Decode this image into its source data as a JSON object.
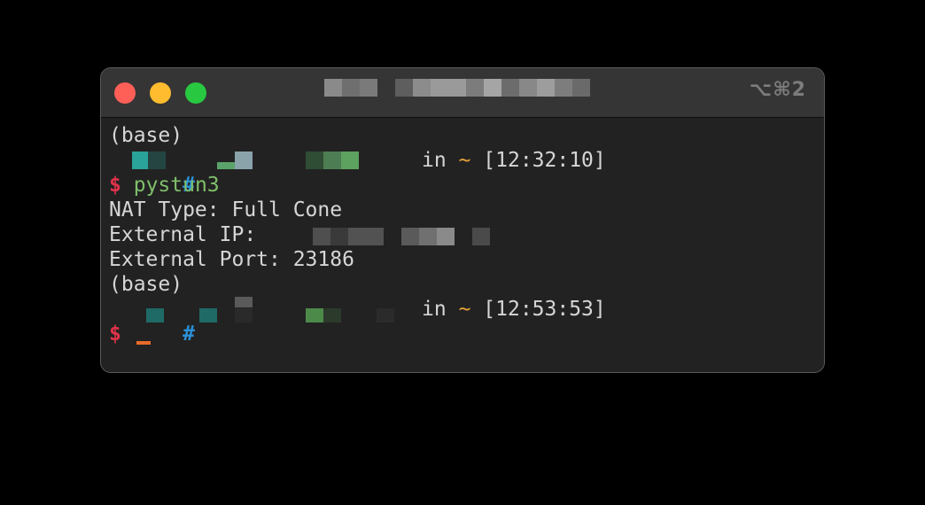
{
  "window": {
    "shortcut": "⌥⌘2"
  },
  "terminal": {
    "lines": {
      "base1": "(base)",
      "prompt1": {
        "hash": "#",
        "in": "in",
        "dir": "~",
        "time": "[12:32:10]"
      },
      "cmd1": {
        "dollar": "$",
        "command": "pystun3"
      },
      "nat_type": "NAT Type: Full Cone",
      "external_ip": "External IP:",
      "external_port": "External Port: 23186",
      "base2": "(base)",
      "prompt2": {
        "hash": "#",
        "in": "in",
        "dir": "~",
        "time": "[12:53:53]"
      },
      "cmd2": {
        "dollar": "$"
      }
    }
  },
  "colors": {
    "close": "#fe5f57",
    "minimize": "#febc2e",
    "maximize": "#28c840",
    "prompt_hash": "#2a8fd6",
    "prompt_dollar": "#e0334a",
    "command": "#7fbf6a",
    "tilde": "#e8a13a",
    "cursor": "#e86a2a"
  }
}
